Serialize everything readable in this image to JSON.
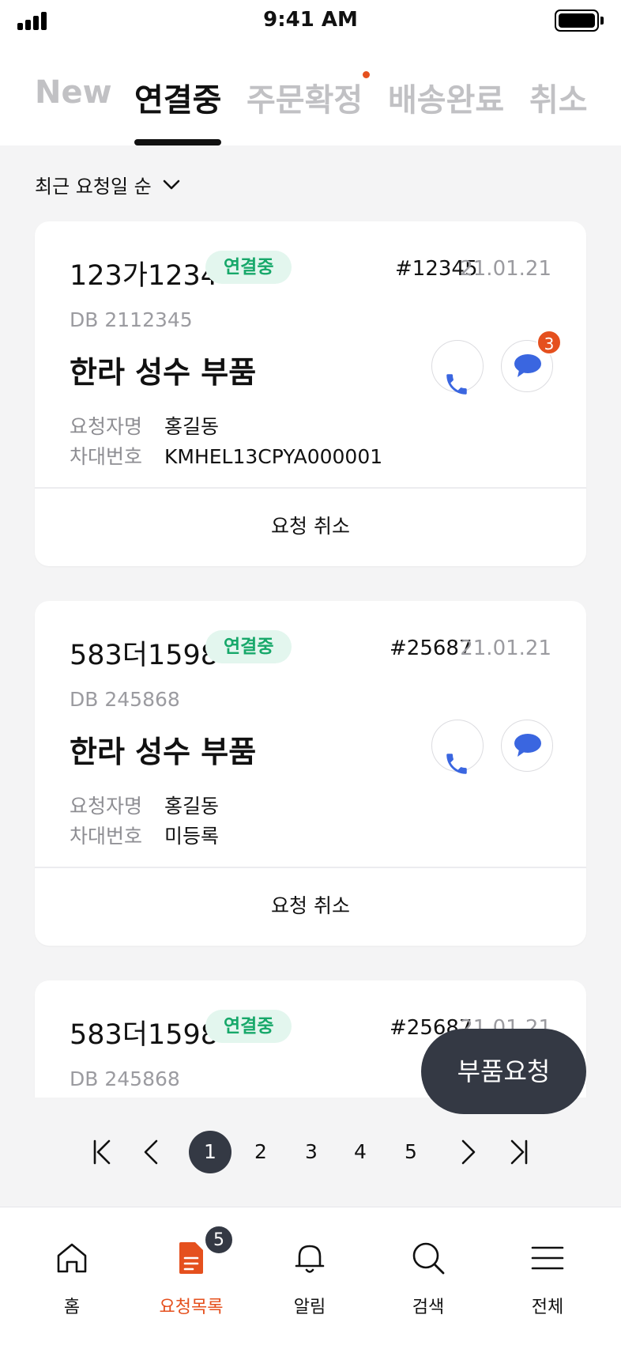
{
  "status_bar": {
    "time": "9:41 AM"
  },
  "tabs": [
    {
      "label": "New",
      "active": false
    },
    {
      "label": "연결중",
      "active": true
    },
    {
      "label": "주문확정",
      "active": false,
      "has_dot": true
    },
    {
      "label": "배송완료",
      "active": false
    },
    {
      "label": "취소",
      "active": false
    }
  ],
  "sort": {
    "label": "최근 요청일 순"
  },
  "cards": [
    {
      "plate": "123가1234",
      "status": "연결중",
      "code": "#12345",
      "date": "21.01.21",
      "db": "DB 2112345",
      "title": "한라 성수 부품",
      "requester_label": "요청자명",
      "requester": "홍길동",
      "vin_label": "차대번호",
      "vin": "KMHEL13CPYA000001",
      "chat_count": "3",
      "cancel_label": "요청 취소"
    },
    {
      "plate": "583더1598",
      "status": "연결중",
      "code": "#25687",
      "date": "21.01.21",
      "db": "DB 245868",
      "title": "한라 성수 부품",
      "requester_label": "요청자명",
      "requester": "홍길동",
      "vin_label": "차대번호",
      "vin": "미등록",
      "cancel_label": "요청 취소"
    },
    {
      "plate": "583더1598",
      "status": "연결중",
      "code": "#25687",
      "date": "21.01.21",
      "db": "DB 245868"
    }
  ],
  "fab": {
    "label": "부품요청"
  },
  "pagination": {
    "current": "1",
    "pages": [
      "1",
      "2",
      "3",
      "4",
      "5"
    ]
  },
  "bottom_nav": [
    {
      "label": "홈",
      "icon": "home-icon"
    },
    {
      "label": "요청목록",
      "icon": "document-icon",
      "active": true,
      "badge": "5"
    },
    {
      "label": "알림",
      "icon": "bell-icon"
    },
    {
      "label": "검색",
      "icon": "search-icon"
    },
    {
      "label": "전체",
      "icon": "menu-icon"
    }
  ],
  "colors": {
    "accent": "#e5501e",
    "status_green": "#17a86a",
    "status_bg": "#e3f6ee",
    "dark": "#343944",
    "icon_blue": "#3a66e0"
  }
}
